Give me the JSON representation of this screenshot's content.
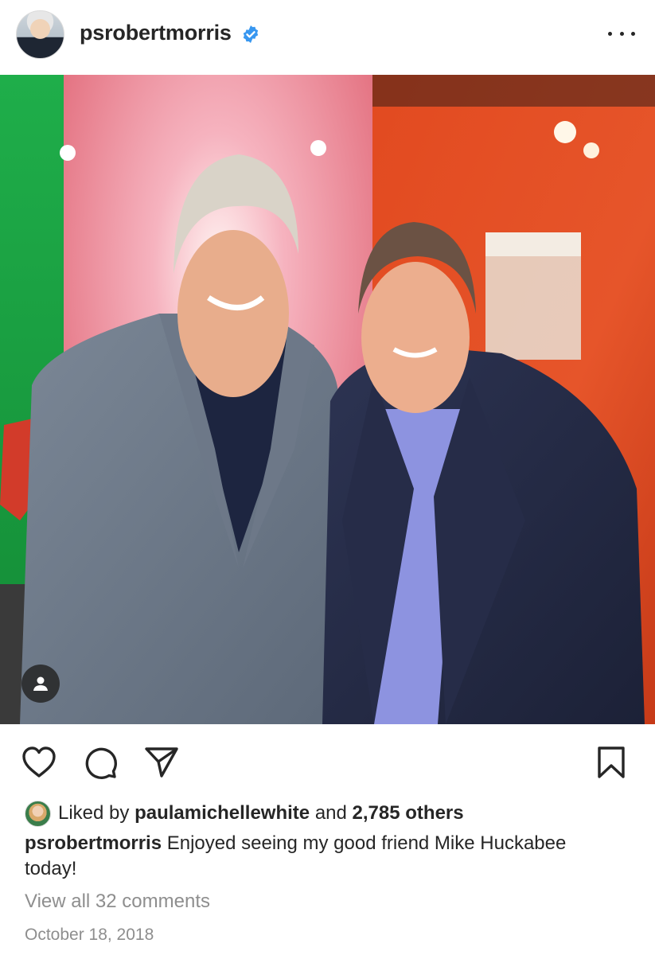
{
  "post": {
    "username": "psrobertmorris",
    "verified": true,
    "verified_icon": "verified-badge-icon",
    "more_icon": "more-options-icon",
    "photo_alt_subjects": [
      "two men in suits posing in front of colored walls"
    ],
    "user_tag_icon": "tagged-user-icon"
  },
  "actions": {
    "like_icon": "heart-icon",
    "comment_icon": "comment-icon",
    "share_icon": "share-icon",
    "save_icon": "bookmark-icon"
  },
  "likes": {
    "prefix": "Liked by",
    "liker": "paulamichellewhite",
    "conjunction": "and",
    "others": "2,785 others"
  },
  "caption": {
    "username": "psrobertmorris",
    "text": "Enjoyed seeing my good friend Mike Huckabee today!"
  },
  "comments": {
    "label": "View all 32 comments"
  },
  "date": "October 18, 2018",
  "colors": {
    "text": "#262626",
    "muted": "#8e8e8e",
    "verified": "#3897f0"
  }
}
